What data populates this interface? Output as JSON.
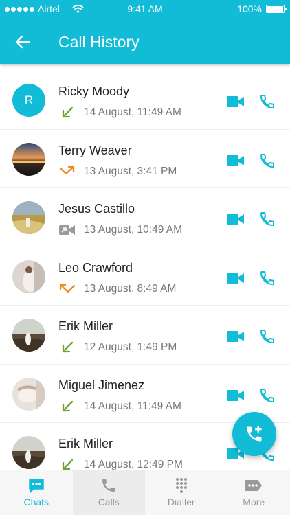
{
  "status_bar": {
    "carrier": "Airtel",
    "time": "9:41 AM",
    "battery": "100%"
  },
  "header": {
    "title": "Call History"
  },
  "calls": [
    {
      "name": "Ricky Moody",
      "initial": "R",
      "time": "14 August, 11:49 AM",
      "type": "incoming"
    },
    {
      "name": "Terry Weaver",
      "time": "13 August, 3:41 PM",
      "type": "outgoing"
    },
    {
      "name": "Jesus Castillo",
      "time": "13 August, 10:49 AM",
      "type": "video"
    },
    {
      "name": "Leo Crawford",
      "time": "13 August, 8:49 AM",
      "type": "missed"
    },
    {
      "name": "Erik Miller",
      "time": "12 August, 1:49 PM",
      "type": "incoming"
    },
    {
      "name": "Miguel Jimenez",
      "time": "14 August, 11:49 AM",
      "type": "incoming"
    },
    {
      "name": "Erik Miller",
      "time": "14 August, 12:49 PM",
      "type": "incoming"
    }
  ],
  "nav": [
    {
      "label": "Chats",
      "icon": "chat-icon"
    },
    {
      "label": "Calls",
      "icon": "phone-icon"
    },
    {
      "label": "Dialler",
      "icon": "dialpad-icon"
    },
    {
      "label": "More",
      "icon": "more-icon"
    }
  ],
  "colors": {
    "accent": "#12bcd6",
    "incoming": "#6aa534",
    "outgoing": "#f08a24",
    "video_call": "#9a9a9a"
  }
}
